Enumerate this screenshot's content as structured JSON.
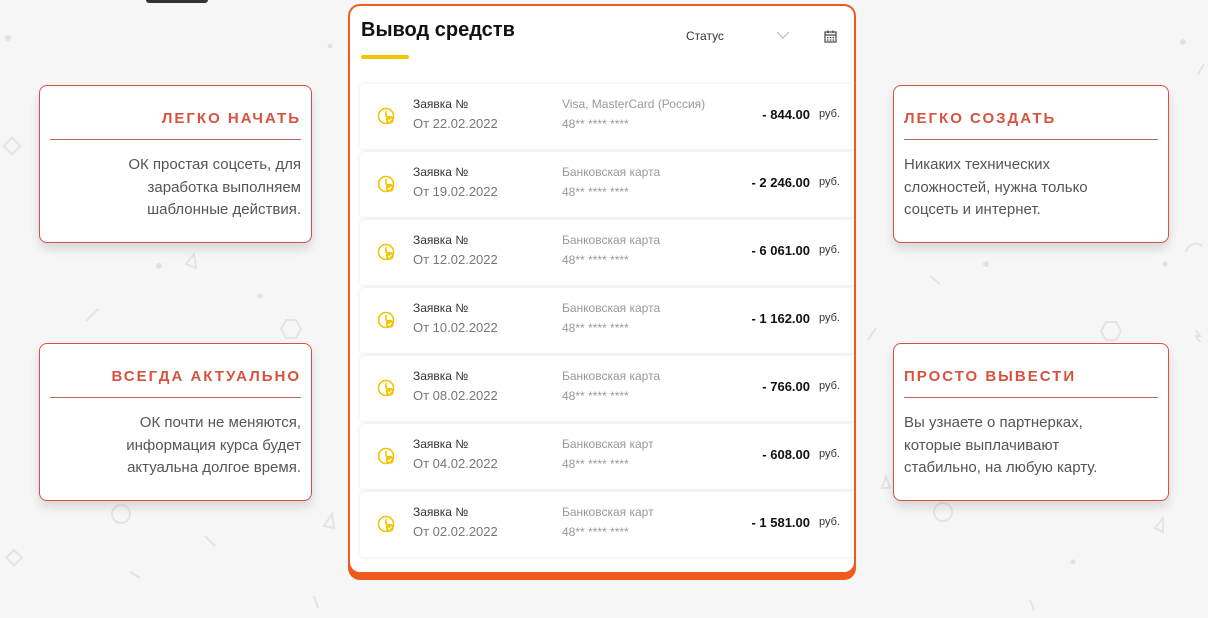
{
  "features": [
    {
      "title": "ЛЕГКО НАЧАТЬ",
      "lines": [
        "ОК простая соцсеть, для",
        "заработка выполняем",
        "шаблонные действия."
      ]
    },
    {
      "title": "ВСЕГДА АКТУАЛЬНО",
      "lines": [
        "ОК почти не меняются,",
        "информация курса будет",
        "актуальна долгое время."
      ]
    },
    {
      "title": "ЛЕГКО СОЗДАТЬ",
      "lines": [
        "Никаких технических",
        "сложностей, нужна только",
        "соцсеть и интернет."
      ]
    },
    {
      "title": "ПРОСТО ВЫВЕСТИ",
      "lines": [
        "Вы узнаете о партнерках,",
        "которые выплачивают",
        "стабильно, на любую карту."
      ]
    }
  ],
  "withdrawal": {
    "title": "Вывод средств",
    "status_label": "Статус",
    "rows": [
      {
        "title": "Заявка №",
        "date": "От 22.02.2022",
        "method": "Visa, MasterCard (Россия)",
        "card": "48** **** ****",
        "amount": "- 844.00",
        "currency": "руб."
      },
      {
        "title": "Заявка №",
        "date": "От 19.02.2022",
        "method": "Банковская карта",
        "card": "48** **** ****",
        "amount": "- 2 246.00",
        "currency": "руб."
      },
      {
        "title": "Заявка №",
        "date": "От 12.02.2022",
        "method": "Банковская карта",
        "card": "48** **** ****",
        "amount": "- 6 061.00",
        "currency": "руб."
      },
      {
        "title": "Заявка №",
        "date": "От 10.02.2022",
        "method": "Банковская карта",
        "card": "48** **** ****",
        "amount": "- 1 162.00",
        "currency": "руб."
      },
      {
        "title": "Заявка №",
        "date": "От 08.02.2022",
        "method": "Банковская карта",
        "card": "48** **** ****",
        "amount": "- 766.00",
        "currency": "руб."
      },
      {
        "title": "Заявка №",
        "date": "От 04.02.2022",
        "method": "Банковская карт",
        "card": "48** **** ****",
        "amount": "- 608.00",
        "currency": "руб."
      },
      {
        "title": "Заявка №",
        "date": "От 02.02.2022",
        "method": "Банковская карт",
        "card": "48** **** ****",
        "amount": "- 1 581.00",
        "currency": "руб."
      }
    ]
  },
  "colors": {
    "accent": "#d5533f",
    "panel_border": "#ef5a1e",
    "underline": "#f2c500",
    "icon": "#f2c500"
  }
}
